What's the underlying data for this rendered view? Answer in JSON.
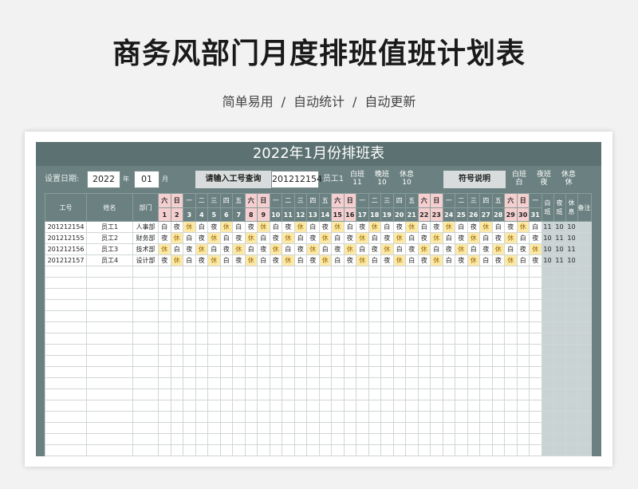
{
  "page": {
    "title": "商务风部门月度排班值班计划表",
    "subtitle_parts": [
      "简单易用",
      "自动统计",
      "自动更新"
    ],
    "separator": "/"
  },
  "sheet": {
    "banner": "2022年1月份排班表",
    "date_label": "设置日期:",
    "year": "2022",
    "year_unit": "年",
    "month": "01",
    "month_unit": "月",
    "query_label": "请输入工号查询",
    "query_value": "201212154",
    "employee_name": "员工1",
    "stat_headers": [
      [
        "白班",
        "11"
      ],
      [
        "晚班",
        "10"
      ],
      [
        "休息",
        "10"
      ]
    ],
    "legend_label": "符号说明",
    "legend_headers": [
      [
        "白班",
        "白"
      ],
      [
        "夜班",
        "夜"
      ],
      [
        "休息",
        "休"
      ]
    ],
    "colors": {
      "panel": "#6b8080",
      "weekend": "#f5cfcf",
      "rest": "#fce9a8"
    }
  },
  "table": {
    "col_headers": {
      "id": "工号",
      "name": "姓名",
      "dept": "部门",
      "day": "白班",
      "night": "夜班",
      "rest": "休息",
      "note": "备注"
    },
    "weekdays": [
      "六",
      "日",
      "一",
      "二",
      "三",
      "四",
      "五",
      "六",
      "日",
      "一",
      "二",
      "三",
      "四",
      "五",
      "六",
      "日",
      "一",
      "二",
      "三",
      "四",
      "五",
      "六",
      "日",
      "一",
      "二",
      "三",
      "四",
      "五",
      "六",
      "日",
      "一"
    ],
    "weekend_days": [
      1,
      2,
      8,
      9,
      15,
      16,
      22,
      23,
      29,
      30
    ],
    "rows": [
      {
        "id": "201212154",
        "name": "员工1",
        "dept": "人事部",
        "shifts": [
          "白",
          "夜",
          "休",
          "白",
          "夜",
          "休",
          "白",
          "夜",
          "休",
          "白",
          "夜",
          "休",
          "白",
          "夜",
          "休",
          "白",
          "夜",
          "休",
          "白",
          "夜",
          "休",
          "白",
          "夜",
          "休",
          "白",
          "夜",
          "休",
          "白",
          "夜",
          "休",
          "白"
        ],
        "day": "11",
        "night": "10",
        "rest": "10"
      },
      {
        "id": "201212155",
        "name": "员工2",
        "dept": "财务部",
        "shifts": [
          "夜",
          "休",
          "白",
          "夜",
          "休",
          "白",
          "夜",
          "休",
          "白",
          "夜",
          "休",
          "白",
          "夜",
          "休",
          "白",
          "夜",
          "休",
          "白",
          "夜",
          "休",
          "白",
          "夜",
          "休",
          "白",
          "夜",
          "休",
          "白",
          "夜",
          "休",
          "白",
          "夜"
        ],
        "day": "10",
        "night": "11",
        "rest": "10"
      },
      {
        "id": "201212156",
        "name": "员工3",
        "dept": "技术部",
        "shifts": [
          "休",
          "白",
          "夜",
          "休",
          "白",
          "夜",
          "休",
          "白",
          "夜",
          "休",
          "白",
          "夜",
          "休",
          "白",
          "夜",
          "休",
          "白",
          "夜",
          "休",
          "白",
          "夜",
          "休",
          "白",
          "夜",
          "休",
          "白",
          "夜",
          "休",
          "白",
          "夜",
          "休"
        ],
        "day": "10",
        "night": "10",
        "rest": "11"
      },
      {
        "id": "201212157",
        "name": "员工4",
        "dept": "设计部",
        "shifts": [
          "夜",
          "休",
          "白",
          "夜",
          "休",
          "白",
          "夜",
          "休",
          "白",
          "夜",
          "休",
          "白",
          "夜",
          "休",
          "白",
          "夜",
          "休",
          "白",
          "夜",
          "休",
          "白",
          "夜",
          "休",
          "白",
          "夜",
          "休",
          "白",
          "夜",
          "休",
          "白",
          "夜"
        ],
        "day": "10",
        "night": "11",
        "rest": "10"
      }
    ],
    "empty_rows": 17
  }
}
